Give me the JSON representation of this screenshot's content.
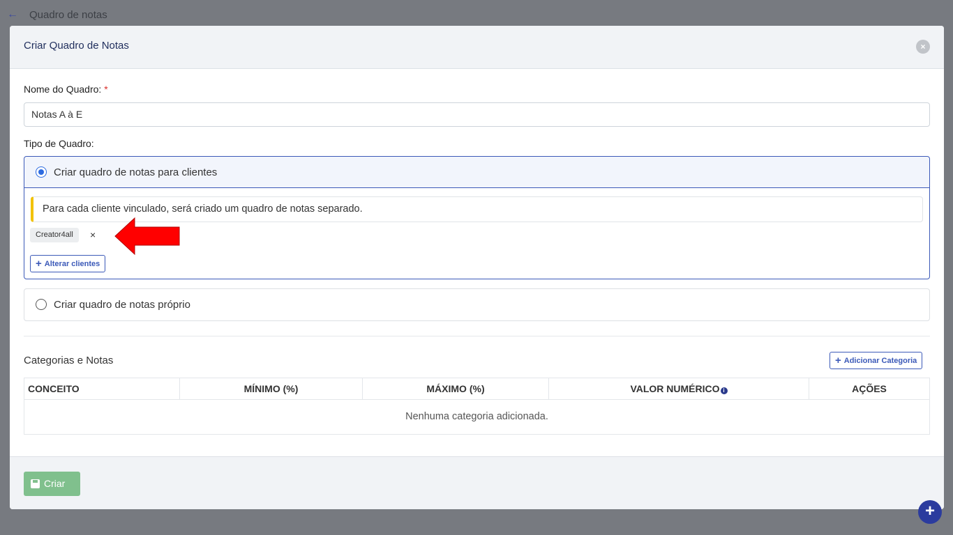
{
  "background": {
    "back_icon": "←",
    "title": "Quadro de notas"
  },
  "modal": {
    "title": "Criar Quadro de Notas",
    "close_icon": "×",
    "board_name": {
      "label": "Nome do Quadro:",
      "required_mark": "*",
      "value": "Notas A à E"
    },
    "board_type": {
      "label": "Tipo de Quadro:",
      "options": [
        {
          "label": "Criar quadro de notas para clientes",
          "selected": true
        },
        {
          "label": "Criar quadro de notas próprio",
          "selected": false
        }
      ],
      "info_text": "Para cada cliente vinculado, será criado um quadro de notas separado.",
      "client_tags": [
        {
          "label": "Creator4all",
          "remove_icon": "×"
        }
      ],
      "change_clients_label": "Alterar clientes"
    },
    "categories": {
      "title": "Categorias e Notas",
      "add_label": "Adicionar Categoria",
      "columns": [
        "CONCEITO",
        "MÍNIMO (%)",
        "MÁXIMO (%)",
        "VALOR NUMÉRICO",
        "AÇÕES"
      ],
      "info_icon": "i",
      "empty_text": "Nenhuma categoria adicionada."
    },
    "footer": {
      "create_label": "Criar"
    }
  },
  "fab_icon": "+",
  "colors": {
    "accent": "#3b59b8",
    "create_button": "#80c08d",
    "fab": "#2b3b9e",
    "required": "#d9302c",
    "alert_border": "#f2c200",
    "annotation_arrow": "#ff0000"
  }
}
